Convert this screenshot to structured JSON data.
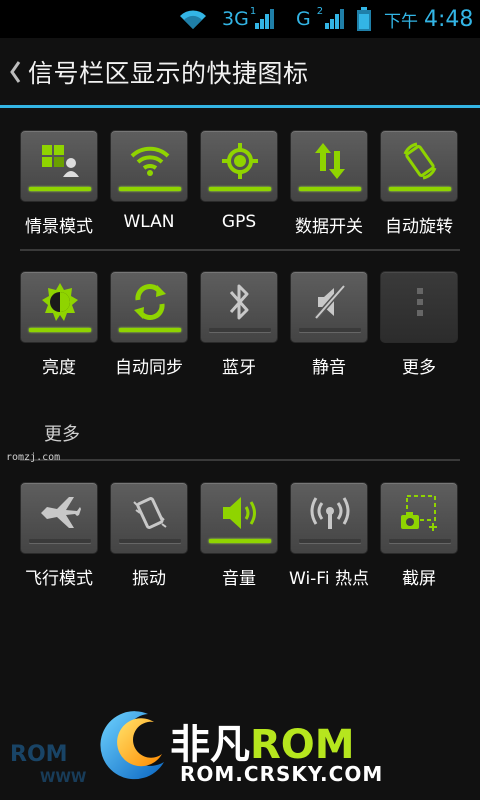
{
  "status_bar": {
    "network1": "3G",
    "sim1": "1",
    "network2": "G",
    "sim2": "2",
    "ampm": "下午",
    "time": "4:48",
    "accent_color": "#33b5e5"
  },
  "header": {
    "title": "信号栏区显示的快捷图标"
  },
  "rows": [
    {
      "tiles": [
        {
          "label": "情景模式",
          "icon": "profiles-icon",
          "on": true
        },
        {
          "label": "WLAN",
          "icon": "wifi-icon",
          "on": true
        },
        {
          "label": "GPS",
          "icon": "gps-icon",
          "on": true
        },
        {
          "label": "数据开关",
          "icon": "data-transfer-icon",
          "on": true
        },
        {
          "label": "自动旋转",
          "icon": "auto-rotate-icon",
          "on": true
        }
      ]
    },
    {
      "tiles": [
        {
          "label": "亮度",
          "icon": "brightness-icon",
          "on": true
        },
        {
          "label": "自动同步",
          "icon": "sync-icon",
          "on": true
        },
        {
          "label": "蓝牙",
          "icon": "bluetooth-icon",
          "on": false
        },
        {
          "label": "静音",
          "icon": "mute-icon",
          "on": false
        },
        {
          "label": "更多",
          "icon": "more-dots-icon",
          "on": false
        }
      ]
    },
    {
      "tiles": [
        {
          "label": "飞行模式",
          "icon": "airplane-icon",
          "on": false
        },
        {
          "label": "振动",
          "icon": "vibrate-icon",
          "on": false
        },
        {
          "label": "音量",
          "icon": "volume-icon",
          "on": true
        },
        {
          "label": "Wi-Fi 热点",
          "icon": "wifi-hotspot-icon",
          "on": false
        },
        {
          "label": "截屏",
          "icon": "screenshot-icon",
          "on": false
        }
      ]
    }
  ],
  "more_section": {
    "label": "更多"
  },
  "watermark": {
    "small": "romzj.com",
    "brand_cn": "非凡",
    "brand_en": "ROM",
    "url": "ROM.CRSKY.COM",
    "ghost": "ROM",
    "ghost_url": "WWW"
  },
  "colors": {
    "active_bar": "#8fd400",
    "inactive_bar": "#3a3a3a",
    "icon_active": "#8fd400",
    "icon_inactive": "#c8c8c8"
  }
}
